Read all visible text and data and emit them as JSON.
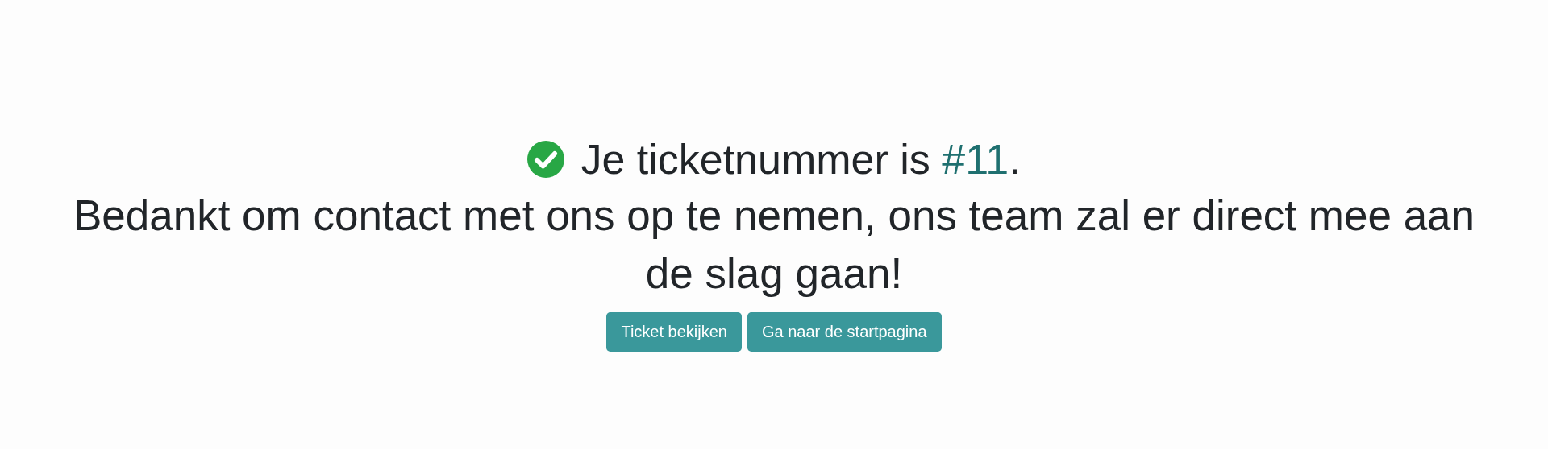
{
  "confirmation": {
    "text_before": "Je ticketnummer is ",
    "ticket_number": "#11",
    "text_after": ".",
    "message": "Bedankt om contact met ons op te nemen, ons team zal er direct mee aan de slag gaan!"
  },
  "buttons": [
    {
      "label": "Ticket bekijken"
    },
    {
      "label": "Ga naar de startpagina"
    }
  ]
}
